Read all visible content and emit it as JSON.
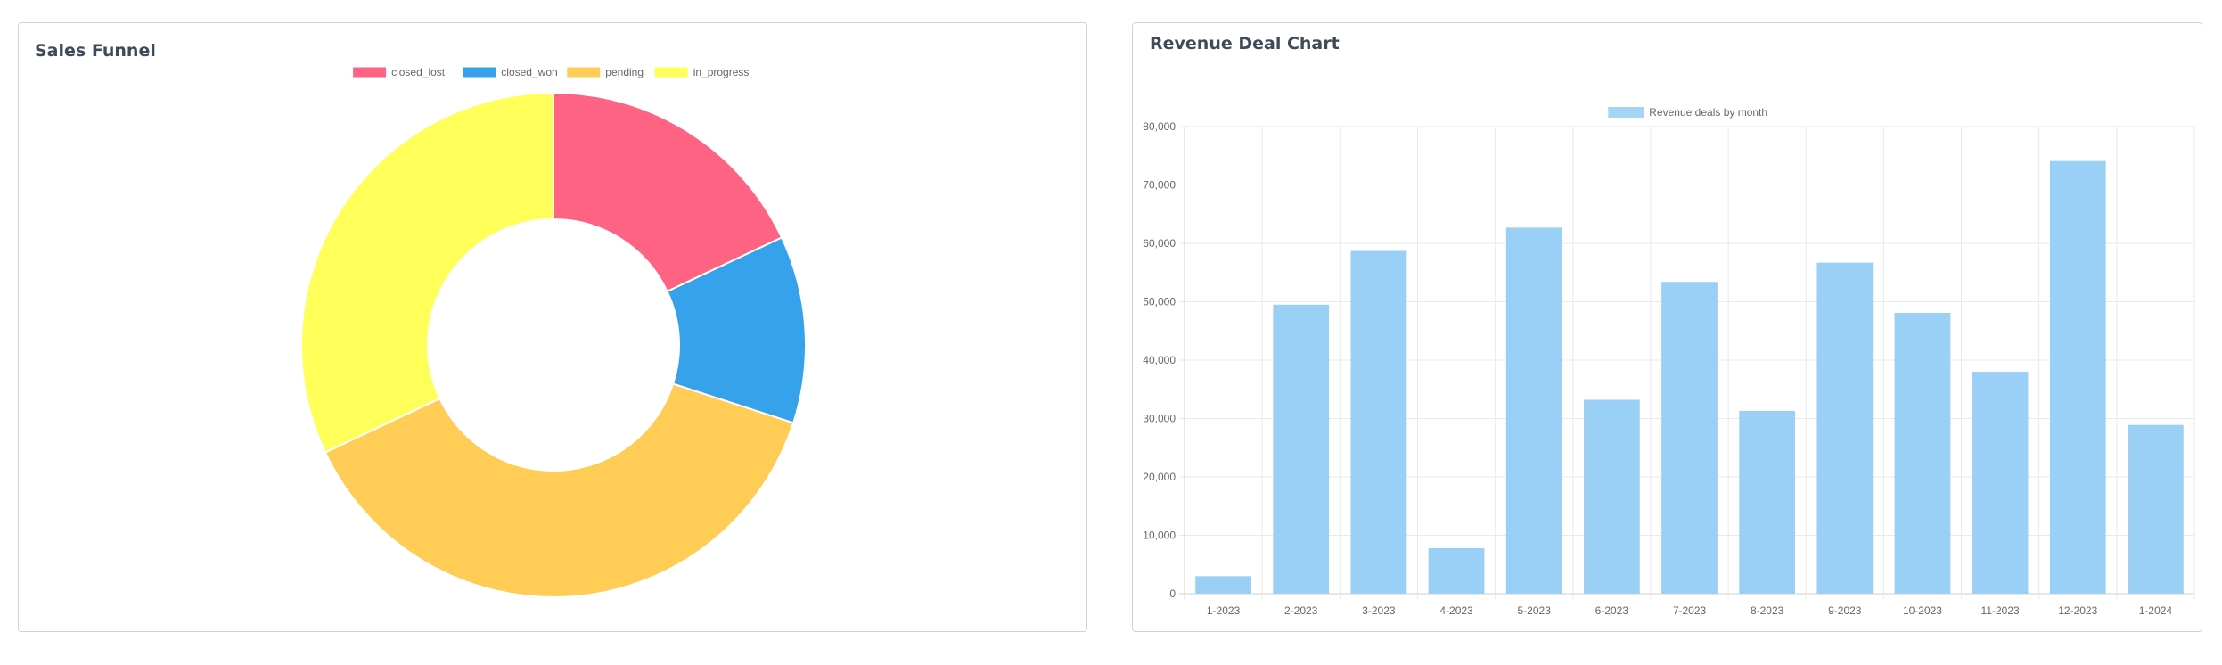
{
  "funnel": {
    "title": "Sales Funnel",
    "chart_data": {
      "type": "pie",
      "variant": "doughnut",
      "labels": [
        "closed_lost",
        "closed_won",
        "pending",
        "in_progress"
      ],
      "values": [
        18,
        12,
        38,
        32
      ],
      "colors": [
        "#ff6384",
        "#36a2eb",
        "#ffcd56",
        "#ffff5a"
      ],
      "legend": "top"
    }
  },
  "revenue": {
    "title": "Revenue Deal Chart",
    "chart_data": {
      "type": "bar",
      "categories": [
        "1-2023",
        "2-2023",
        "3-2023",
        "4-2023",
        "5-2023",
        "6-2023",
        "7-2023",
        "8-2023",
        "9-2023",
        "10-2023",
        "11-2023",
        "12-2023",
        "1-2024"
      ],
      "series": [
        {
          "name": "Revenue deals by month",
          "values": [
            3000,
            49500,
            58700,
            7800,
            62700,
            33200,
            53400,
            31300,
            56700,
            48100,
            38000,
            74100,
            28900
          ]
        }
      ],
      "ylim": [
        0,
        80000
      ],
      "yticks": [
        "0",
        "10,000",
        "20,000",
        "30,000",
        "40,000",
        "50,000",
        "60,000",
        "70,000",
        "80,000"
      ],
      "grid": true,
      "legend": "top",
      "color": "#9ad0f5"
    }
  }
}
